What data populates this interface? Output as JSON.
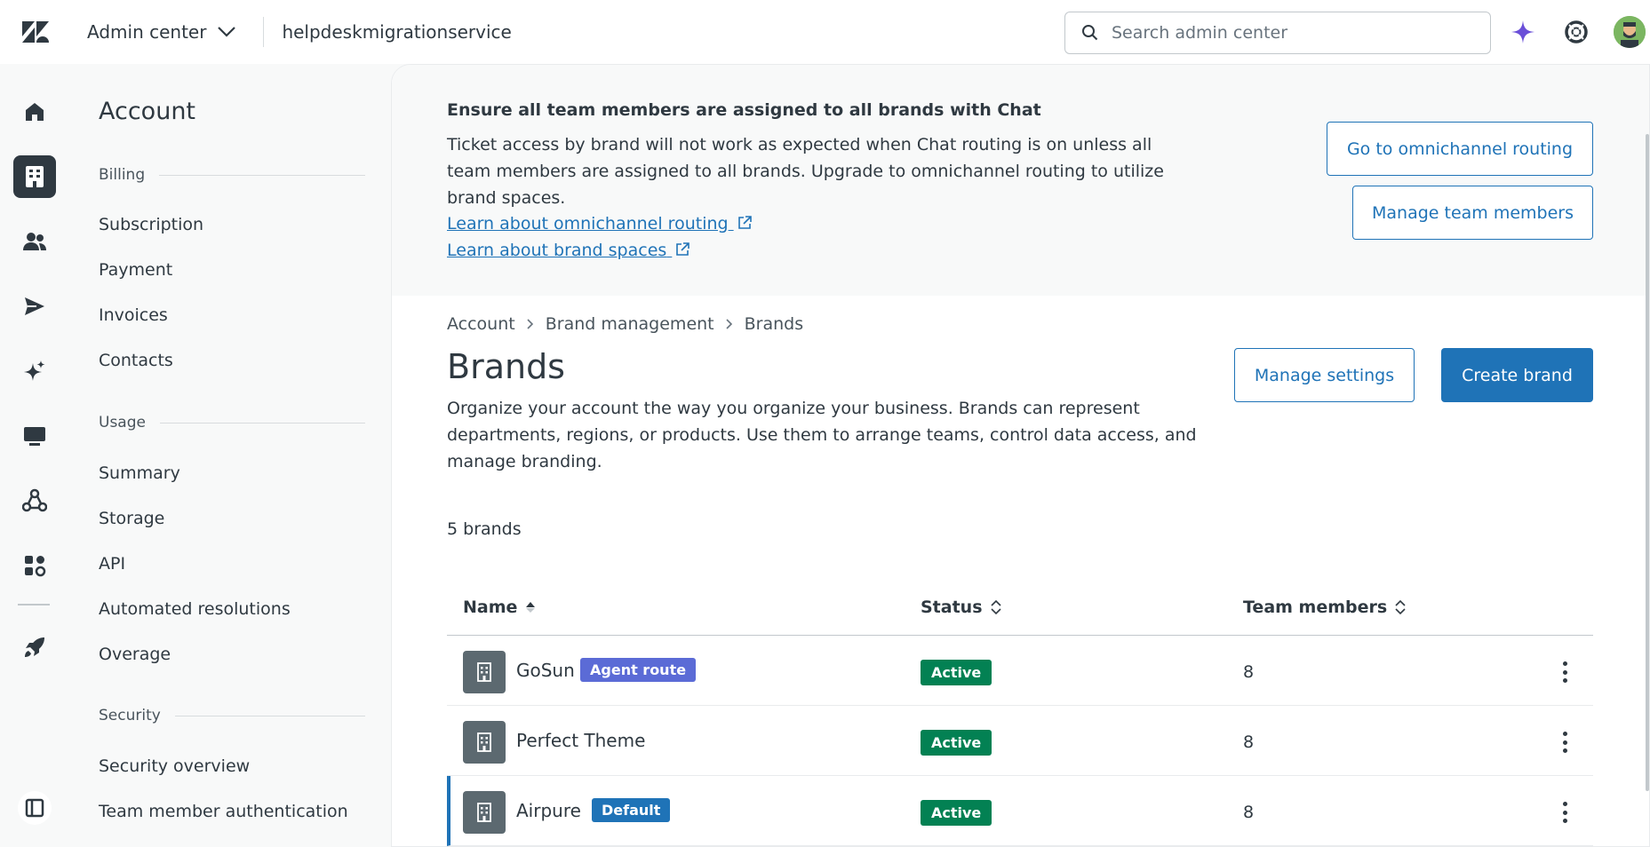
{
  "topbar": {
    "product": "Admin center",
    "subdomain": "helpdeskmigrationservice",
    "search_placeholder": "Search admin center"
  },
  "secnav": {
    "title": "Account",
    "groups": [
      {
        "label": "Billing",
        "items": [
          "Subscription",
          "Payment",
          "Invoices",
          "Contacts"
        ]
      },
      {
        "label": "Usage",
        "items": [
          "Summary",
          "Storage",
          "API",
          "Automated resolutions",
          "Overage"
        ]
      },
      {
        "label": "Security",
        "items": [
          "Security overview",
          "Team member authentication"
        ]
      }
    ]
  },
  "banner": {
    "title": "Ensure all team members are assigned to all brands with Chat",
    "body": "Ticket access by brand will not work as expected when Chat routing is on unless all team members are assigned to all brands. Upgrade to omnichannel routing to utilize brand spaces.",
    "link1": "Learn about omnichannel routing",
    "link2": "Learn about brand spaces",
    "btn_routing": "Go to omnichannel routing",
    "btn_team": "Manage team members"
  },
  "breadcrumb": [
    "Account",
    "Brand management",
    "Brands"
  ],
  "page": {
    "title": "Brands",
    "description": "Organize your account the way you organize your business. Brands can represent departments, regions, or products. Use them to arrange teams, control data access, and manage branding.",
    "manage_settings": "Manage settings",
    "create_brand": "Create brand",
    "count": "5 brands"
  },
  "table": {
    "columns": [
      "Name",
      "Status",
      "Team members"
    ],
    "rows": [
      {
        "name": "GoSun",
        "tag": "Agent route",
        "tag_color": "#5b6bd6",
        "status": "Active",
        "members": "8"
      },
      {
        "name": "Perfect Theme",
        "tag": "",
        "tag_color": "",
        "status": "Active",
        "members": "8"
      },
      {
        "name": "Airpure",
        "tag": "Default",
        "tag_color": "#1f73b7",
        "status": "Active",
        "members": "8"
      }
    ]
  },
  "colors": {
    "accent": "#1f73b7",
    "active_status": "#038153",
    "ai_icon": "#6a4fd8"
  }
}
